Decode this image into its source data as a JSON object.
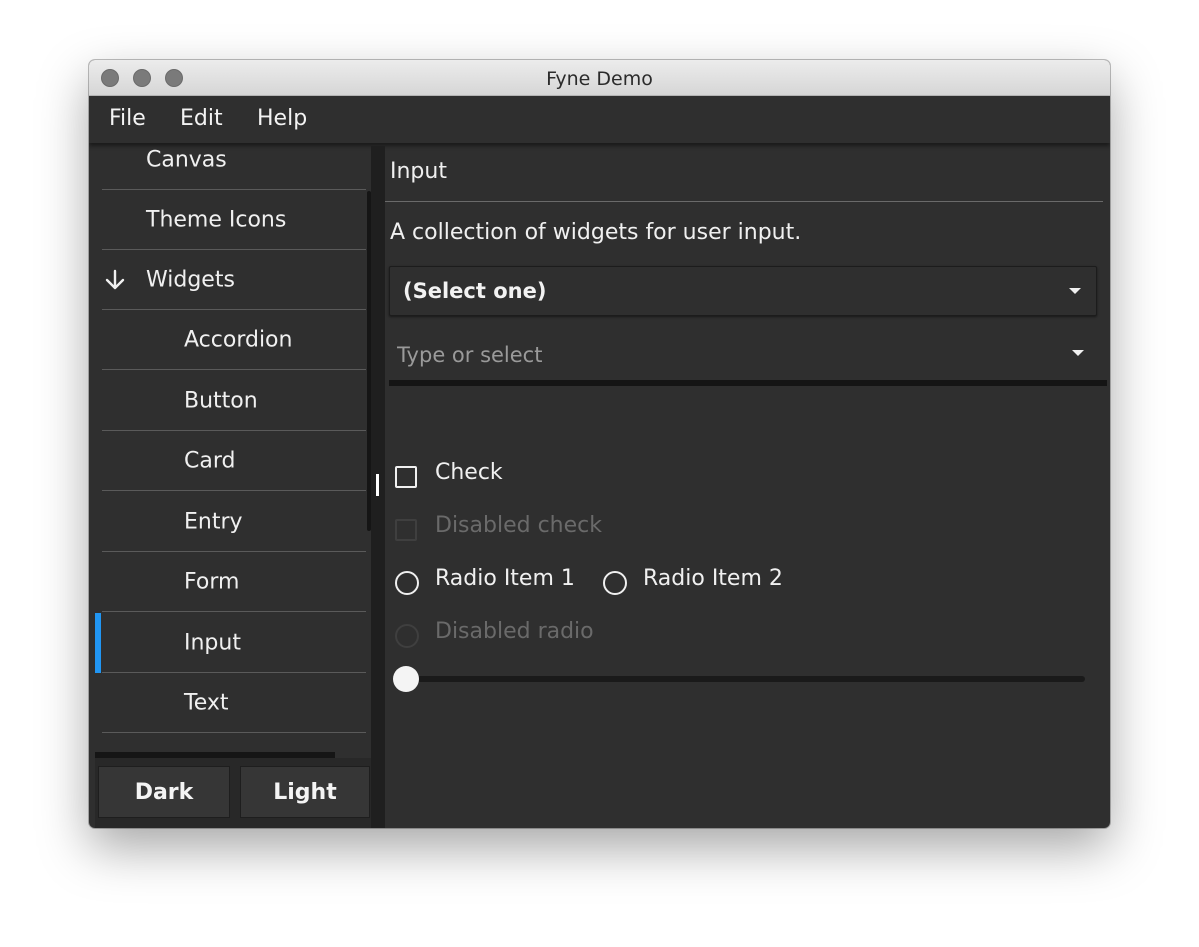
{
  "window": {
    "title": "Fyne Demo"
  },
  "menu": {
    "items": [
      "File",
      "Edit",
      "Help"
    ]
  },
  "sidebar": {
    "items": [
      {
        "label": "Canvas"
      },
      {
        "label": "Theme Icons"
      },
      {
        "label": "Widgets",
        "expanded": true
      },
      {
        "label": "Accordion"
      },
      {
        "label": "Button"
      },
      {
        "label": "Card"
      },
      {
        "label": "Entry"
      },
      {
        "label": "Form"
      },
      {
        "label": "Input",
        "selected": true
      },
      {
        "label": "Text"
      }
    ],
    "accent_color": "#2196f3"
  },
  "footer": {
    "dark_label": "Dark",
    "light_label": "Light"
  },
  "content": {
    "title": "Input",
    "description": "A collection of widgets for user input.",
    "select": {
      "selected": "(Select one)"
    },
    "select_entry": {
      "placeholder": "Type or select",
      "value": ""
    },
    "check": {
      "label": "Check",
      "checked": false
    },
    "disabled_check": {
      "label": "Disabled check"
    },
    "radio": {
      "items": [
        "Radio Item 1",
        "Radio Item 2"
      ],
      "selected": null
    },
    "disabled_radio": {
      "label": "Disabled radio"
    },
    "slider": {
      "value": 0
    }
  }
}
